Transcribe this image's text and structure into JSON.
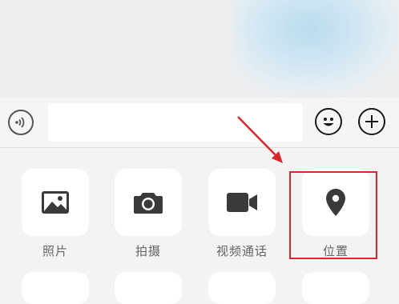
{
  "input_bar": {
    "voice_icon": "voice-icon",
    "text_value": "",
    "emoji_icon": "emoji-icon",
    "plus_icon": "plus-icon"
  },
  "panel": {
    "items": [
      {
        "label": "照片",
        "icon": "image-icon"
      },
      {
        "label": "拍摄",
        "icon": "camera-icon"
      },
      {
        "label": "视频通话",
        "icon": "video-call-icon"
      },
      {
        "label": "位置",
        "icon": "location-pin-icon"
      }
    ]
  },
  "colors": {
    "highlight": "#d7282c",
    "icon": "#3a3a3a",
    "label": "#666666"
  }
}
